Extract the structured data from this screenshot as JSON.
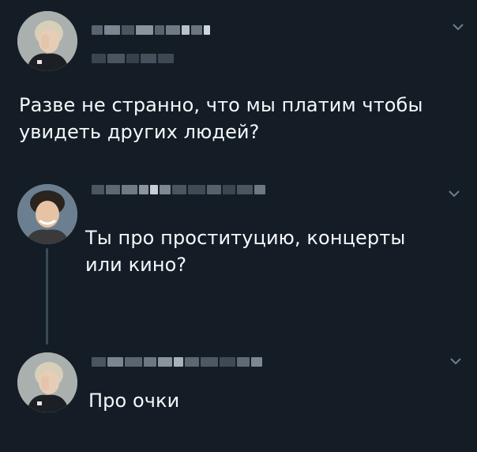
{
  "colors": {
    "background": "#141d26",
    "text": "#f5f8fa",
    "muted": "#6f7d8a",
    "thread_line": "#3b4a57"
  },
  "tweets": [
    {
      "author_avatar": "avatar-blonde-hand-over-face",
      "author_name_redacted": true,
      "handle_redacted": true,
      "text_line1": "Разве не странно, что мы платим чтобы",
      "text_line2": "увидеть других людей?"
    },
    {
      "author_avatar": "avatar-dark-hair-smiling",
      "author_name_redacted": true,
      "text_line1": "Ты про проституцию, концерты",
      "text_line2": "или кино?"
    },
    {
      "author_avatar": "avatar-blonde-hand-over-face",
      "author_name_redacted": true,
      "text_line1": "Про очки"
    }
  ],
  "icons": {
    "menu": "chevron-down-icon"
  }
}
